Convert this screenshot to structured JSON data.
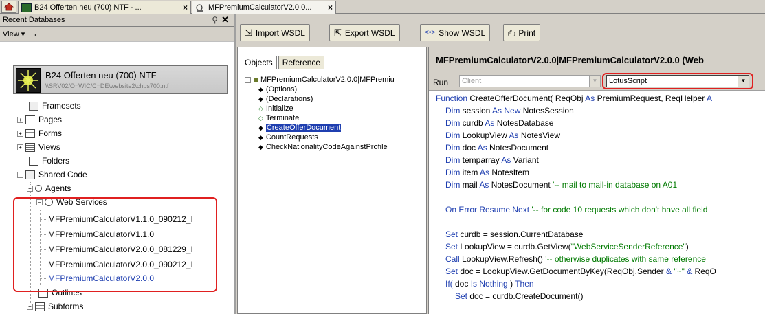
{
  "tabs": [
    {
      "label": "B24 Offerten neu (700) NTF - ..."
    },
    {
      "label": "MFPremiumCalculatorV2.0.0..."
    }
  ],
  "left_panel": {
    "title": "Recent Databases",
    "view_label": "View ▾",
    "database": {
      "title": "B24 Offerten neu (700) NTF",
      "path": "\\\\SRV02/O=WIC/C=DE\\website2\\chbs700.ntf"
    },
    "tree": [
      "Framesets",
      "Pages",
      "Forms",
      "Views",
      "Folders",
      "Shared Code",
      "Agents",
      "Web Services",
      "MFPremiumCalculatorV1.1.0_090212_I",
      "MFPremiumCalculatorV1.1.0",
      "MFPremiumCalculatorV2.0.0_081229_I",
      "MFPremiumCalculatorV2.0.0_090212_I",
      "MFPremiumCalculatorV2.0.0",
      "Outlines",
      "Subforms"
    ]
  },
  "toolbar": {
    "import_label": "Import WSDL",
    "export_label": "Export WSDL",
    "show_label": "Show WSDL",
    "print_label": "Print"
  },
  "objects_panel": {
    "tab_objects": "Objects",
    "tab_reference": "Reference",
    "root": "MFPremiumCalculatorV2.0.0|MFPremiu",
    "items": [
      "(Options)",
      "(Declarations)",
      "Initialize",
      "Terminate",
      "CreateOfferDocument",
      "CountRequests",
      "CheckNationalityCodeAgainstProfile"
    ]
  },
  "editor": {
    "title": "MFPremiumCalculatorV2.0.0|MFPremiumCalculatorV2.0.0 (Web",
    "run_label": "Run",
    "run_value": "Client",
    "language_value": "LotusScript"
  },
  "code_lines": [
    {
      "segs": [
        [
          "kw",
          "Function "
        ],
        [
          "nm",
          "CreateOfferDocument( ReqObj "
        ],
        [
          "kw",
          "As "
        ],
        [
          "nm",
          "PremiumRequest, ReqHelper "
        ],
        [
          "kw",
          "A"
        ]
      ]
    },
    {
      "segs": [
        [
          "kw",
          "Dim "
        ],
        [
          "nm",
          "session "
        ],
        [
          "kw",
          "As New "
        ],
        [
          "nm",
          "NotesSession"
        ]
      ]
    },
    {
      "segs": [
        [
          "kw",
          "Dim "
        ],
        [
          "nm",
          "curdb "
        ],
        [
          "kw",
          "As "
        ],
        [
          "nm",
          "NotesDatabase"
        ]
      ]
    },
    {
      "segs": [
        [
          "kw",
          "Dim "
        ],
        [
          "nm",
          "LookupView "
        ],
        [
          "kw",
          "As "
        ],
        [
          "nm",
          "NotesView"
        ]
      ]
    },
    {
      "segs": [
        [
          "kw",
          "Dim "
        ],
        [
          "nm",
          "doc "
        ],
        [
          "kw",
          "As "
        ],
        [
          "nm",
          "NotesDocument"
        ]
      ]
    },
    {
      "segs": [
        [
          "kw",
          "Dim "
        ],
        [
          "nm",
          "temparray "
        ],
        [
          "kw",
          "As "
        ],
        [
          "nm",
          "Variant"
        ]
      ]
    },
    {
      "segs": [
        [
          "kw",
          "Dim "
        ],
        [
          "nm",
          "item "
        ],
        [
          "kw",
          "As "
        ],
        [
          "nm",
          "NotesItem"
        ]
      ]
    },
    {
      "segs": [
        [
          "kw",
          "Dim "
        ],
        [
          "nm",
          "mail "
        ],
        [
          "kw",
          "As "
        ],
        [
          "nm",
          "NotesDocument  "
        ],
        [
          "cm",
          "'-- mail to mail-in database on A01"
        ]
      ]
    },
    {
      "segs": []
    },
    {
      "segs": [
        [
          "kw",
          "On Error Resume Next   "
        ],
        [
          "cm",
          "'-- for code 10 requests which don't have all field"
        ]
      ]
    },
    {
      "segs": []
    },
    {
      "segs": [
        [
          "kw",
          "Set "
        ],
        [
          "nm",
          "curdb = session.CurrentDatabase"
        ]
      ]
    },
    {
      "segs": [
        [
          "kw",
          "Set "
        ],
        [
          "nm",
          "LookupView = curdb.GetView("
        ],
        [
          "cm",
          "\"WebServiceSenderReference\""
        ],
        [
          "nm",
          ")"
        ]
      ]
    },
    {
      "segs": [
        [
          "kw",
          "Call "
        ],
        [
          "nm",
          "LookupView.Refresh()  "
        ],
        [
          "cm",
          "'-- otherwise duplicates with same reference"
        ]
      ]
    },
    {
      "segs": [
        [
          "kw",
          "Set "
        ],
        [
          "nm",
          "doc = LookupView.GetDocumentByKey(ReqObj.Sender "
        ],
        [
          "kw",
          "& "
        ],
        [
          "cm",
          "\"~\" "
        ],
        [
          "kw",
          "& "
        ],
        [
          "nm",
          "ReqO"
        ]
      ]
    },
    {
      "segs": [
        [
          "kw",
          "If( "
        ],
        [
          "nm",
          "doc "
        ],
        [
          "kw",
          "Is Nothing "
        ],
        [
          "nm",
          ") "
        ],
        [
          "kw",
          "Then"
        ]
      ]
    },
    {
      "segs": [
        [
          "kw",
          "Set "
        ],
        [
          "nm",
          "doc = curdb.CreateDocument()"
        ]
      ]
    }
  ],
  "colors": {
    "highlight": "#e02020",
    "keyword": "#1f3fb0",
    "comment": "#007a00"
  }
}
